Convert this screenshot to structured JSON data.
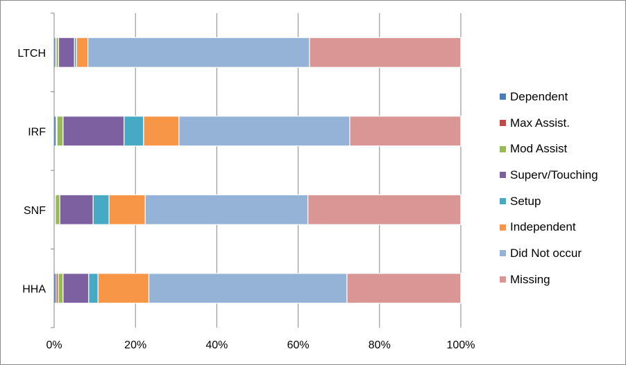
{
  "chart_data": {
    "type": "bar",
    "orientation": "horizontal",
    "stacked": "percent",
    "title": "",
    "xlabel": "",
    "ylabel": "",
    "xlim": [
      0,
      100
    ],
    "x_ticks": [
      "0%",
      "20%",
      "40%",
      "60%",
      "80%",
      "100%"
    ],
    "categories": [
      "LTCH",
      "IRF",
      "SNF",
      "HHA"
    ],
    "grid": true,
    "legend_position": "right",
    "series": [
      {
        "name": "Dependent",
        "color": "#4A7EBB",
        "values": [
          0.4,
          0.5,
          0.2,
          0.5
        ]
      },
      {
        "name": "Max Assist.",
        "color": "#BE4B48",
        "values": [
          0.1,
          0.2,
          0.1,
          0.5
        ]
      },
      {
        "name": "Mod Assist",
        "color": "#98B954",
        "values": [
          0.6,
          1.5,
          1.1,
          1.2
        ]
      },
      {
        "name": "Superv/Touching",
        "color": "#7D60A0",
        "values": [
          3.9,
          15.0,
          8.2,
          6.3
        ]
      },
      {
        "name": "Setup",
        "color": "#46AAC5",
        "values": [
          0.5,
          4.8,
          3.9,
          2.3
        ]
      },
      {
        "name": "Independent",
        "color": "#F79646",
        "values": [
          2.8,
          8.7,
          8.9,
          12.5
        ]
      },
      {
        "name": "Did Not occur",
        "color": "#95B3D7",
        "values": [
          54.5,
          42.0,
          40.0,
          48.7
        ]
      },
      {
        "name": "Missing",
        "color": "#D99694",
        "values": [
          37.2,
          27.3,
          37.6,
          28.0
        ]
      }
    ]
  }
}
